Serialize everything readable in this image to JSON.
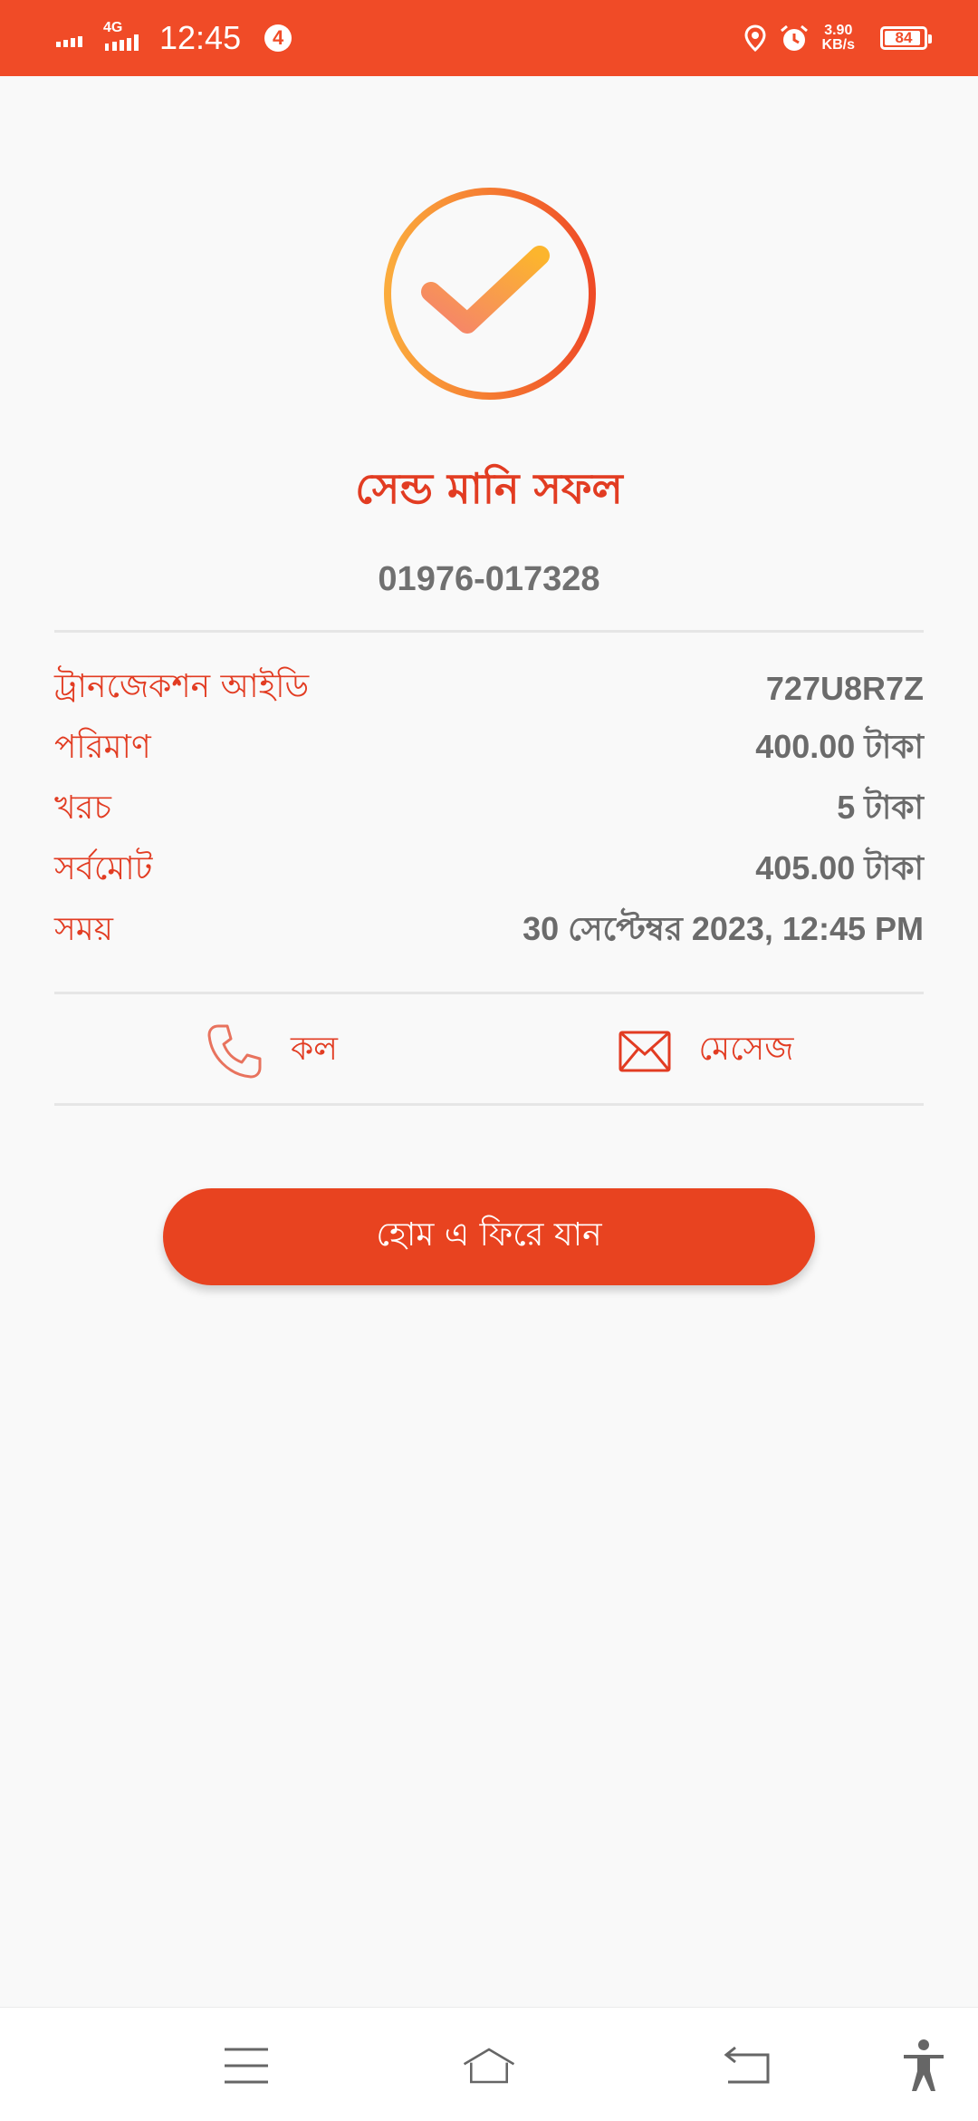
{
  "status_bar": {
    "time": "12:45",
    "network": "4G",
    "notification_count": "4",
    "speed_value": "3.90",
    "speed_unit": "KB/s",
    "battery": "84"
  },
  "success": {
    "title": "সেন্ড মানি সফল",
    "phone": "01976-017328"
  },
  "details": [
    {
      "label": "ট্রানজেকশন আইডি",
      "value": "727U8R7Z"
    },
    {
      "label": "পরিমাণ",
      "value": "400.00 টাকা"
    },
    {
      "label": "খরচ",
      "value": "5 টাকা"
    },
    {
      "label": "সর্বমোট",
      "value": "405.00 টাকা"
    },
    {
      "label": "সময়",
      "value": "30 সেপ্টেম্বর 2023, 12:45 PM"
    }
  ],
  "actions": {
    "call_label": "কল",
    "message_label": "মেসেজ"
  },
  "home_button_label": "হোম এ ফিরে যান",
  "colors": {
    "brand": "#f04b27",
    "accent_text": "#e23c22",
    "button": "#e84320"
  }
}
